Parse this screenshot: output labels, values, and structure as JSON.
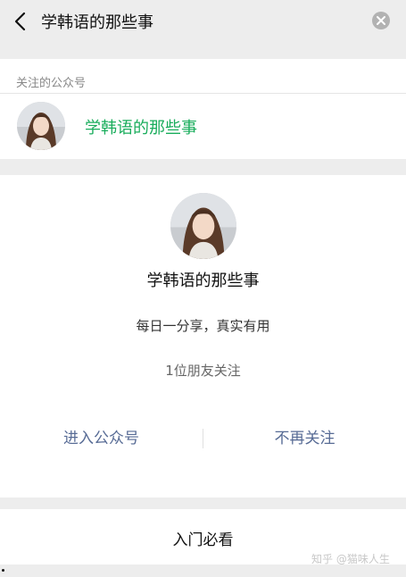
{
  "header": {
    "title": "学韩语的那些事",
    "back_icon": "chevron-left-icon",
    "clear_icon": "close-circle-icon"
  },
  "followed": {
    "section_label": "关注的公众号",
    "account_name": "学韩语的那些事",
    "name_color": "#1aad5c"
  },
  "profile": {
    "name": "学韩语的那些事",
    "description": "每日一分享，真实有用",
    "friends_following": "1位朋友关注",
    "enter_label": "进入公众号",
    "unfollow_label": "不再关注",
    "link_color": "#576b95"
  },
  "bottom": {
    "title": "入门必看"
  },
  "watermark": {
    "text": "知乎 @猫味人生"
  }
}
